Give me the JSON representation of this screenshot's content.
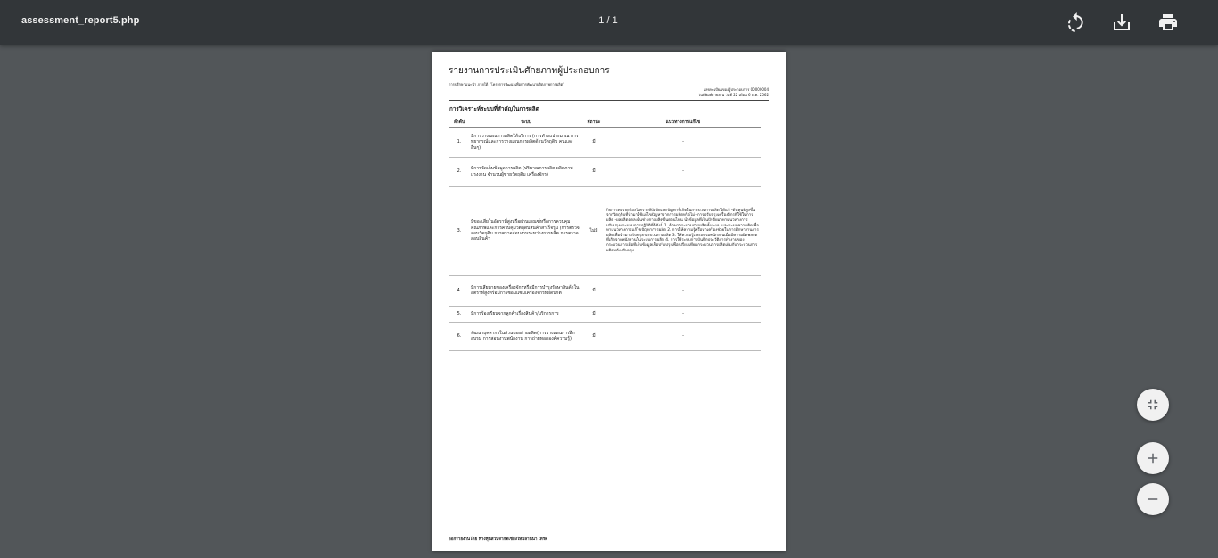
{
  "toolbar": {
    "file_name": "assessment_report5.php",
    "page_indicator": "1 / 1",
    "rotate_icon": "rotate-icon",
    "download_icon": "download-icon",
    "print_icon": "print-icon"
  },
  "document": {
    "title": "รายงานการประเมินศักยภาพผู้ประกอบการ",
    "subtitle": "การปรึกษาแนะนำ ภายใต้ “โครงการพัฒนาเพื่อการพัฒนาผลิตภาพการผลิต”",
    "meta_line1": "เลขทะเบียนของผู้ประกอบการ 00000004",
    "meta_line2": "วันที่พิมพ์รายงาน วันที่ 22 เดือน 6 พ.ศ. 2562",
    "section_title": "การวิเคราะห์ระบบที่สำคัญในการผลิต",
    "columns": [
      "ลำดับ",
      "ระบบ",
      "สถานะ",
      "แนวทางการแก้ไข"
    ],
    "rows": [
      {
        "no": "1.",
        "issue": "มีการวางแผนการผลิตให้บริการ (การทำงบประมาณ การพยากรณ์และการวางแผนการผลิตด้านวัตถุดิบ คนและ อื่นๆ)",
        "status": "มี",
        "fix": "-"
      },
      {
        "no": "2.",
        "issue": "มีการจัดเก็บข้อมูลการผลิต (ปริมาณการผลิต ผลิตภาพแรงงาน จำนวนผู้ขายวัตถุดิบ เครื่องจักร)",
        "status": "มี",
        "fix": "-"
      },
      {
        "no": "3.",
        "issue": "มีของเสียในอัตราที่สูงหรือผ่านเกณฑ์หรือการควบคุมคุณภาพและการควบคุมวัตถุดิบสินค้าสำเร็จรูป (การตรวจสอบวัตถุดิบ การตรวจสอบงานระหว่างการผลิต การตรวจสอบสินค้า",
        "status": "ไม่มี",
        "fix": "กิจการควรจะต้องวิเคราะห์ปัจจัยและปัญหาที่เกิดในกระบวนการผลิต ได้แก่ -ต้นทุนที่สูงขึ้นจากวัตถุดิบที่นำมาใช้แก้ไขปัญหาจากการผลิตหรือไม่ -การปรับปรุงเครื่องจักรที่ใช้ในการผลิต -ผลผลิตลดลงในช่วงการผลิตขั้นตอนไหน นำข้อมูลที่เป็นปัจจัยมาหาแนวทางการปรับปรุงกระบวนการปฏิบัติที่ดีดังนี้ 1. ศึกษากระบวนการผลิตทั้งระบบ และระบบความคิดเพื่อหาแนวทางการแก้ไขปัญหาการผลิต 2. การให้ความรู้หรือหาเครื่องช่วยในการศึกษางานการผลิตเพื่อนำมาปรับปรุงกระบวนการผลิต 3. ให้ความรู้และอบรมพนักงานเมื่อมีความผิดพลาดที่เกิดจากพนักงานในระบบการผลิต 4. การใช้ระบบการบันทึกประวัติการทำงานของกระบวนการเพื่อที่เก็บข้อมูลเพื่อปรับปรุงเพื่อเปรียบเทียบกระบวนการผลิตเดิมกับกระบวนการผลิตหลังปรับปรุง"
      },
      {
        "no": "4.",
        "issue": "มีการเสียหายของเครื่องจักรหรือมีการบำรุงรักษาสินค้าในอัตราที่สูงหรือมีการซ่อมแซมเครื่องจักรที่ผิดปกติ",
        "status": "มี",
        "fix": "-"
      },
      {
        "no": "5.",
        "issue": "มีการร้องเรียนจากลูกค้าเรื่องสินค้า/บริการการ",
        "status": "มี",
        "fix": "-"
      },
      {
        "no": "6.",
        "issue": "พัฒนาบุคลากรในส่วนของฝ่ายผลิต(การวางแผนการฝึกอบรม การสอนงานพนักงาน การถ่ายทอดองค์ความรู้)",
        "status": "มี",
        "fix": "-"
      }
    ],
    "footer": "ออกรายงานโดย ห้างหุ้นส่วนจำกัดเชียงใหม่ล้านนา เทรด"
  },
  "controls": {
    "fit_icon": "fit-to-page-icon",
    "zoom_in_icon": "zoom-in-icon",
    "zoom_out_icon": "zoom-out-icon"
  },
  "colors": {
    "toolbar_bg": "#323639",
    "viewer_bg": "#525659",
    "page_bg": "#ffffff"
  }
}
